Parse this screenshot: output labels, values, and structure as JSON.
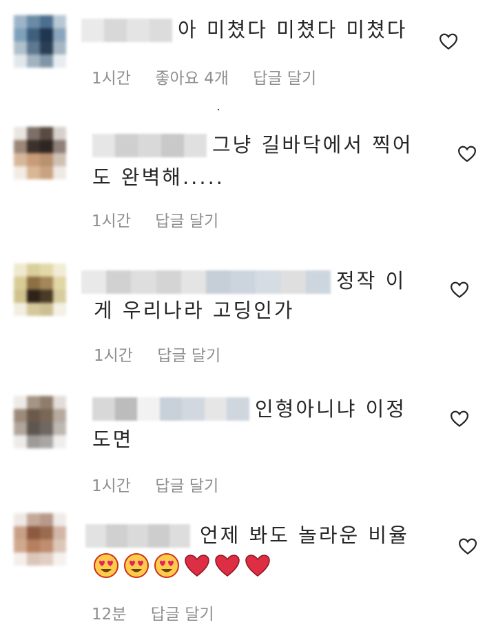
{
  "comments": [
    {
      "line1": "아 미쳤다 미쳤다 미쳤다",
      "line2": "",
      "time": "1시간",
      "likes": "좋아요 4개",
      "reply": "답글 달기"
    },
    {
      "line1": "그냥 길바닥에서 찍어",
      "line2": "도 완벽해.....",
      "time": "1시간",
      "likes": "",
      "reply": "답글 달기"
    },
    {
      "line1": "정작 이",
      "line2": "게 우리나라 고딩인가",
      "time": "1시간",
      "likes": "",
      "reply": "답글 달기"
    },
    {
      "line1": "인형아니냐 이정",
      "line2": "도면",
      "time": "1시간",
      "likes": "",
      "reply": "답글 달기"
    },
    {
      "line1": "언제 봐도 놀라운 비율",
      "line2": "",
      "emojis": [
        "heart-eyes-emoji",
        "heart-eyes-emoji",
        "heart-eyes-emoji",
        "red-heart-emoji",
        "red-heart-emoji",
        "red-heart-emoji"
      ],
      "time": "12분",
      "likes": "",
      "reply": "답글 달기"
    }
  ],
  "colors": {
    "text": "#262626",
    "meta": "#8e8e8e",
    "heart_outline": "#262626",
    "emoji_face": "#ffcb4c",
    "emoji_heart": "#e0245e"
  },
  "icons": {
    "like": "heart-outline-icon"
  }
}
